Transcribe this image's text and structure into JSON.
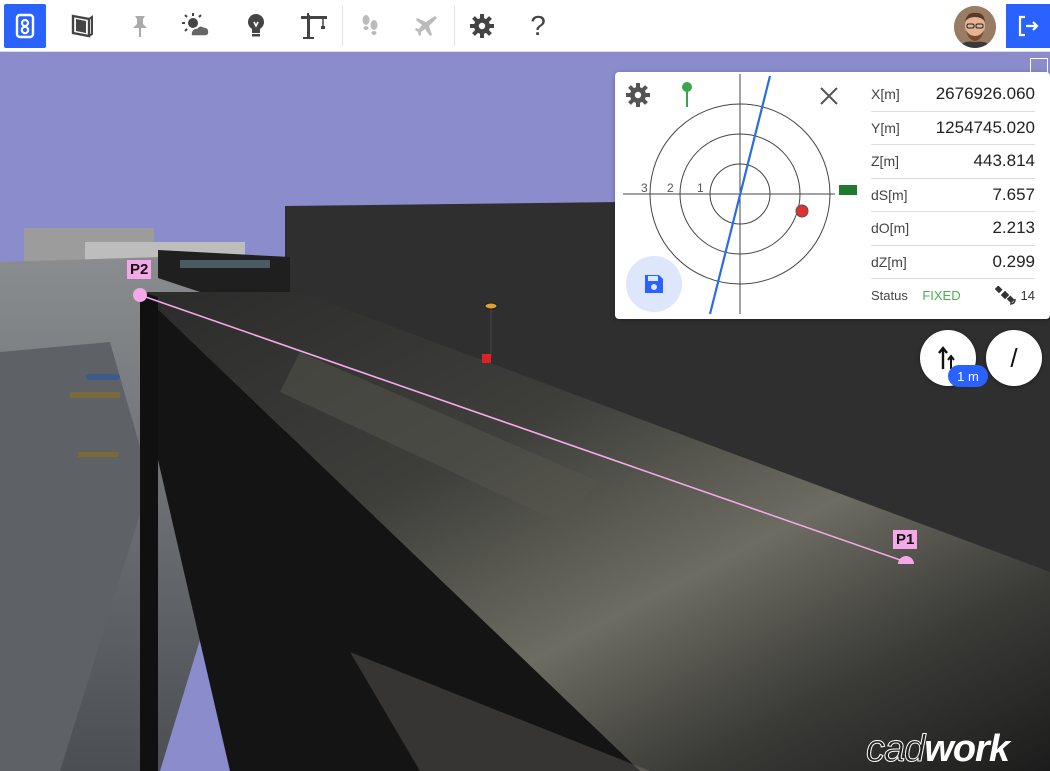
{
  "toolbar": {
    "icons": [
      "app-logo-icon",
      "book-icon",
      "pin-icon",
      "weather-icon",
      "lightbulb-icon",
      "crane-icon",
      "footprints-icon",
      "airplane-icon",
      "settings-icon",
      "help-icon",
      "logout-icon"
    ],
    "help_label": "?",
    "accent": "#2962ff"
  },
  "scene": {
    "p1_label": "P1",
    "p2_label": "P2",
    "line_color": "#f5a8e8",
    "sky_color": "#8b8ccc",
    "watermark_prefix": "cad",
    "watermark_suffix": "work"
  },
  "panel": {
    "ring_labels": [
      "3",
      "2",
      "1"
    ],
    "rows": [
      {
        "key": "X[m]",
        "value": "2676926.060"
      },
      {
        "key": "Y[m]",
        "value": "1254745.020"
      },
      {
        "key": "Z[m]",
        "value": "443.814"
      },
      {
        "key": "dS[m]",
        "value": "7.657"
      },
      {
        "key": "dO[m]",
        "value": "2.213"
      },
      {
        "key": "dZ[m]",
        "value": "0.299"
      }
    ],
    "status_label": "Status",
    "status_value": "FIXED",
    "satellites": "14"
  },
  "controls": {
    "scale_badge": "1 m",
    "slash_label": "/"
  }
}
